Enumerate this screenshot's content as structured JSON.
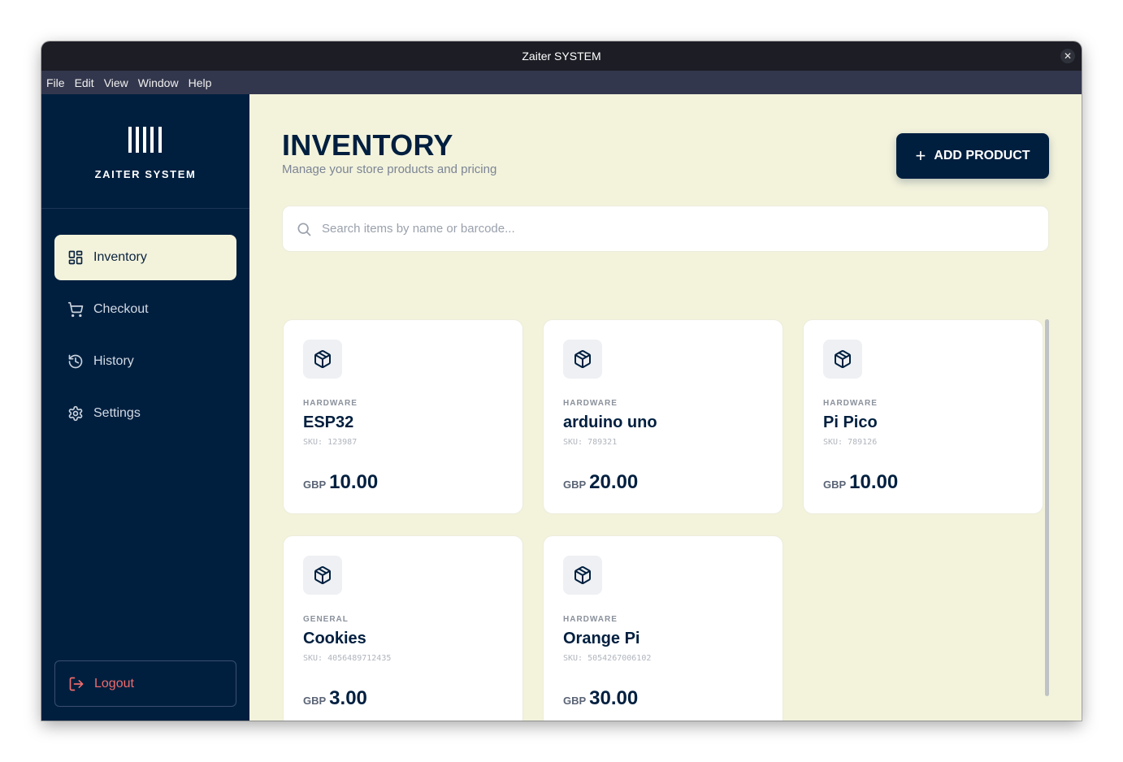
{
  "window": {
    "title": "Zaiter SYSTEM",
    "close_glyph": "✕"
  },
  "menu": [
    "File",
    "Edit",
    "View",
    "Window",
    "Help"
  ],
  "sidebar": {
    "brand": "ZAITER SYSTEM",
    "logo_icon": "barcode-icon",
    "items": [
      {
        "label": "Inventory",
        "icon": "grid-icon",
        "active": true
      },
      {
        "label": "Checkout",
        "icon": "cart-icon",
        "active": false
      },
      {
        "label": "History",
        "icon": "history-icon",
        "active": false
      },
      {
        "label": "Settings",
        "icon": "gear-icon",
        "active": false
      }
    ],
    "logout": "Logout"
  },
  "header": {
    "title": "INVENTORY",
    "subtitle": "Manage your store products and pricing",
    "add_button": "ADD PRODUCT"
  },
  "search": {
    "placeholder": "Search items by name or barcode...",
    "value": ""
  },
  "products": [
    {
      "category": "HARDWARE",
      "name": "ESP32",
      "sku": "SKU: 123987",
      "currency": "GBP",
      "price": "10.00"
    },
    {
      "category": "HARDWARE",
      "name": "arduino uno",
      "sku": "SKU: 789321",
      "currency": "GBP",
      "price": "20.00"
    },
    {
      "category": "HARDWARE",
      "name": "Pi Pico",
      "sku": "SKU: 789126",
      "currency": "GBP",
      "price": "10.00"
    },
    {
      "category": "GENERAL",
      "name": "Cookies",
      "sku": "SKU: 4056489712435",
      "currency": "GBP",
      "price": "3.00"
    },
    {
      "category": "HARDWARE",
      "name": "Orange Pi",
      "sku": "SKU: 5054267006102",
      "currency": "GBP",
      "price": "30.00"
    }
  ],
  "colors": {
    "navy": "#001f3f",
    "cream": "#f3f3dc",
    "logout_red": "#ef6b6b"
  }
}
